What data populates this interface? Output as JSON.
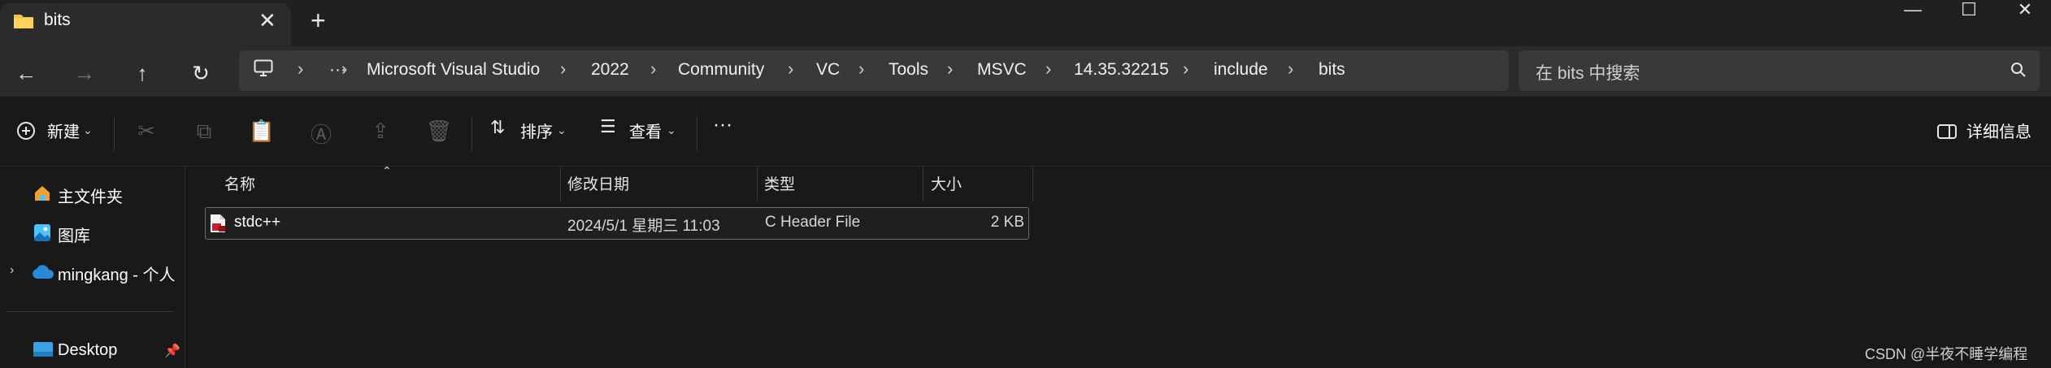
{
  "tab": {
    "title": "bits"
  },
  "breadcrumbs": [
    "Microsoft Visual Studio",
    "2022",
    "Community",
    "VC",
    "Tools",
    "MSVC",
    "14.35.32215",
    "include",
    "bits"
  ],
  "address": {
    "overflow": "···",
    "separator": "›"
  },
  "search": {
    "placeholder": "在 bits 中搜索"
  },
  "toolbar": {
    "new_label": "新建",
    "sort_label": "排序",
    "view_label": "查看",
    "more": "···",
    "details_label": "详细信息"
  },
  "sidebar": {
    "items": [
      {
        "label": "主文件夹",
        "icon": "home-icon"
      },
      {
        "label": "图库",
        "icon": "gallery-icon"
      },
      {
        "label": "mingkang - 个人",
        "icon": "onedrive-cloud-icon"
      },
      {
        "label": "Desktop",
        "icon": "desktop-icon"
      }
    ]
  },
  "columns": {
    "name": "名称",
    "modified": "修改日期",
    "type": "类型",
    "size": "大小"
  },
  "files": [
    {
      "name": "stdc++",
      "modified": "2024/5/1 星期三 11:03",
      "type": "C Header File",
      "size": "2 KB"
    }
  ],
  "watermark": "CSDN @半夜不睡学编程",
  "colors": {
    "background": "#191919",
    "titlebar": "#202020",
    "toolbar_surface": "#2b2b2b",
    "accent_blue": "#4cc2ff"
  }
}
